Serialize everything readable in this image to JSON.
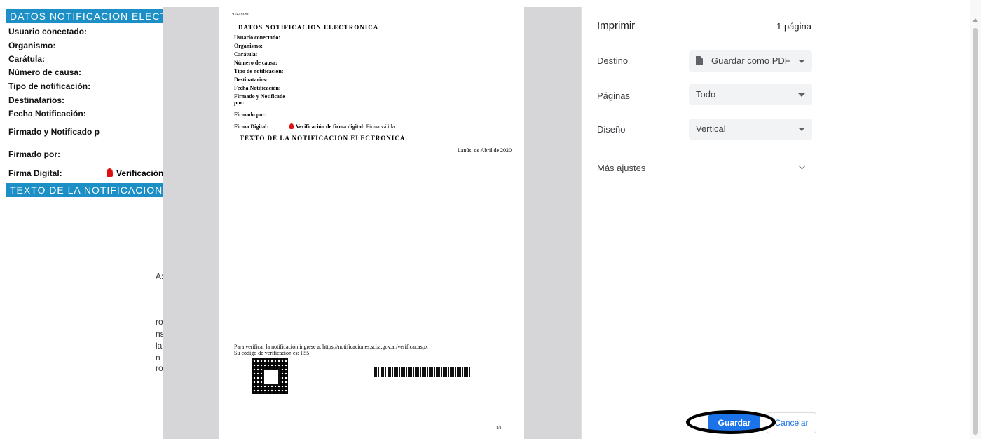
{
  "background": {
    "header1": "DATOS NOTIFICACION ELECTRONICA",
    "rows": [
      "Usuario conectado:",
      "Organismo:",
      "Carátula:",
      "Número de causa:",
      "Tipo de notificación:",
      "Destinatarios:",
      "Fecha Notificación:",
      "Firmado y Notificado p",
      "Firmado por:",
      "Firma Digital:"
    ],
    "verification": "Verificación",
    "header2": "TEXTO DE LA NOTIFICACION ELECTRONICA",
    "fragments": [
      "A:",
      "ro",
      "ns",
      "la",
      "n",
      "ro"
    ]
  },
  "preview": {
    "date": "30/4/2020",
    "title": "DATOS NOTIFICACION ELECTRONICA",
    "fields": [
      "Usuario conectado:",
      "Organismo:",
      "Carátula:",
      "Número de causa:",
      "Tipo de notificación:",
      "Destinatarios:",
      "Fecha Notificación:",
      "Firmado y Notificado",
      "por:",
      "Firmado por:"
    ],
    "firma_label": "Firma Digital:",
    "firma_verif": "Verificación de firma digital:",
    "firma_valida": "Firma válida",
    "texto_title": "TEXTO DE LA NOTIFICACION ELECTRONICA",
    "place_date": "Lanús, de Abril de 2020",
    "verify_line": "Para verificar la notificación ingrese a: https://notificaciones.scba.gov.ar/verificar.aspx",
    "code_line": "Su código de verificación es: P55",
    "page_num": "1/1"
  },
  "panel": {
    "title": "Imprimir",
    "page_count": "1 página",
    "destino_label": "Destino",
    "destino_value": "Guardar como PDF",
    "paginas_label": "Páginas",
    "paginas_value": "Todo",
    "diseno_label": "Diseño",
    "diseno_value": "Vertical",
    "mas_ajustes": "Más ajustes",
    "save_label": "Guardar",
    "cancel_label": "Cancelar"
  },
  "colors": {
    "header_blue": "#1b8fc6",
    "button_blue": "#1a73e8"
  }
}
